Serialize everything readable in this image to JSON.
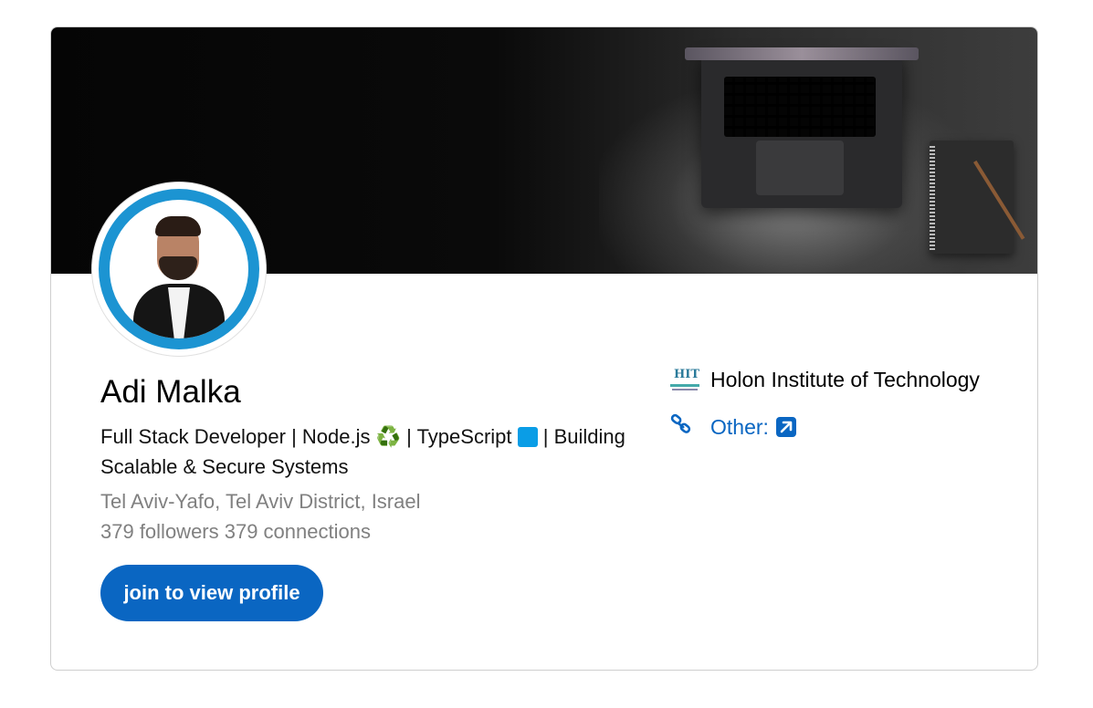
{
  "profile": {
    "name": "Adi Malka",
    "headline_part1": "Full Stack Developer | Node.js ",
    "headline_emoji1": "♻️",
    "headline_part2": " | TypeScript ",
    "headline_part3": " | Building Scalable & Secure Systems",
    "location": "Tel Aviv-Yafo, Tel Aviv District, Israel",
    "stats": "379 followers 379 connections",
    "join_button_label": "join to view profile",
    "avatar_ring_color": "#1c94d2"
  },
  "sidebar": {
    "school_name": "Holon Institute of Technology",
    "school_logo_text": "HIT",
    "other_label": "Other:",
    "school_logo_icon": "hit-logo-icon",
    "link_icon": "link-chain-icon",
    "external_icon": "external-link-icon"
  },
  "colors": {
    "accent": "#0a66c2",
    "muted_text": "#808080"
  }
}
